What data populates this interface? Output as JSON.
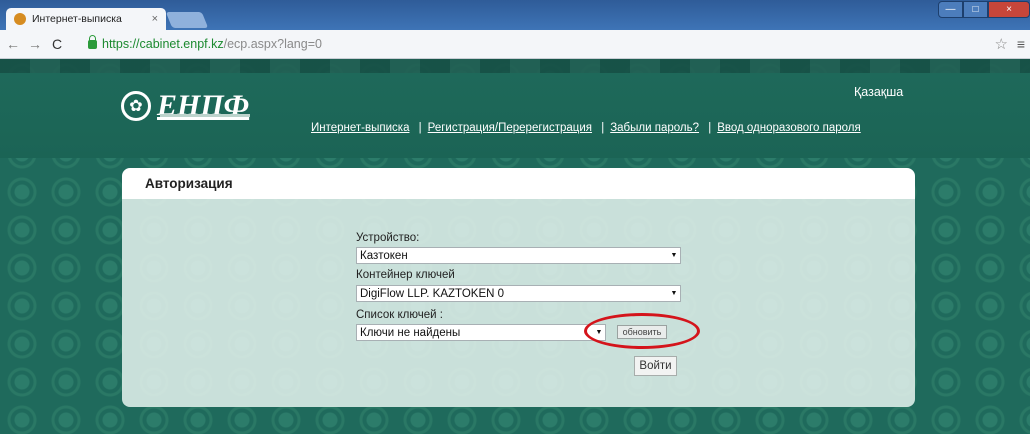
{
  "browser": {
    "tab_title": "Интернет-выписка",
    "tab_close": "×",
    "url_host": "https://cabinet.enpf.kz",
    "url_path": "/ecp.aspx?lang=0",
    "nav_back": "←",
    "nav_forward": "→",
    "nav_reload": "C",
    "bookmark_star": "☆",
    "menu": "≡",
    "window_minimize": "—",
    "window_maximize": "□",
    "window_close": "×"
  },
  "header": {
    "logo_text": "ЕНПФ",
    "language_link": "Қазақша",
    "nav": [
      {
        "label": "Интернет-выписка"
      },
      {
        "label": "Регистрация/Перерегистрация"
      },
      {
        "label": "Забыли пароль?"
      },
      {
        "label": "Ввод одноразового пароля"
      }
    ],
    "nav_separator": "|"
  },
  "auth": {
    "title": "Авторизация",
    "device_label": "Устройство:",
    "device_value": "Казтокен",
    "container_label": "Контейнер ключей",
    "container_value": "DigiFlow LLP. KAZTOKEN 0",
    "keys_label": "Список ключей :",
    "keys_value": "Ключи не найдены",
    "refresh_button": "обновить",
    "login_button": "Войти",
    "highlight_color": "#d4141b"
  },
  "colors": {
    "page_bg": "#1f6a5c",
    "link_text": "#ffffff",
    "secure_url": "#1c8a30"
  }
}
